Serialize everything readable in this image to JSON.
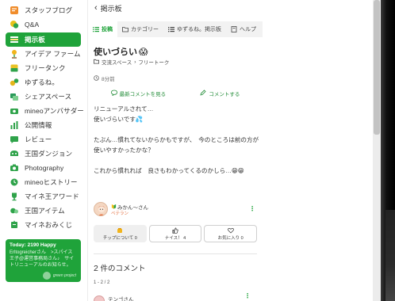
{
  "sidebar": {
    "items": [
      {
        "label": "スタッフブログ",
        "icon": "staff-blog-icon",
        "color": "#f08c2a"
      },
      {
        "label": "Q&A",
        "icon": "qa-icon",
        "color": "#e8c21a"
      },
      {
        "label": "掲示板",
        "icon": "board-icon",
        "color": "#ffffff"
      },
      {
        "label": "アイデア ファーム",
        "icon": "idea-farm-icon",
        "color": "#f2b51c"
      },
      {
        "label": "フリータンク",
        "icon": "free-tank-icon",
        "color": "#e9c225"
      },
      {
        "label": "ゆずるね。",
        "icon": "yuzurune-icon",
        "color": "#e4b51a"
      },
      {
        "label": "シェアスペース",
        "icon": "share-space-icon",
        "color": "#2a9a5a"
      },
      {
        "label": "mineoアンバサダー",
        "icon": "ambassador-icon",
        "color": "#2fa34a"
      },
      {
        "label": "公開情報",
        "icon": "public-info-icon",
        "color": "#2fa34a"
      },
      {
        "label": "レビュー",
        "icon": "review-icon",
        "color": "#2fa34a"
      },
      {
        "label": "王国ダンジョン",
        "icon": "dungeon-icon",
        "color": "#2fa34a"
      },
      {
        "label": "Photography",
        "icon": "camera-icon",
        "color": "#2fa34a"
      },
      {
        "label": "mineoヒストリー",
        "icon": "history-icon",
        "color": "#2fa34a"
      },
      {
        "label": "マイネ王アワード",
        "icon": "trophy-icon",
        "color": "#2fa34a"
      },
      {
        "label": "王国アイテム",
        "icon": "item-icon",
        "color": "#2fa34a"
      },
      {
        "label": "マイネおみくじ",
        "icon": "omikuji-icon",
        "color": "#2fa34a"
      }
    ],
    "active_index": 2,
    "promo": {
      "title": "Today: 2190 Happy",
      "text": "Erltogreicherさん　>スパイス王子@運営事務局さん♪　サイトリニューアルのお知らせ。",
      "brand": "green project"
    }
  },
  "header": {
    "back_icon": "chevron-left-icon",
    "title": "掲示板"
  },
  "tabs": [
    {
      "label": "投稿",
      "icon": "list-icon",
      "active": true
    },
    {
      "label": "カテゴリー",
      "icon": "folder-icon",
      "active": false
    },
    {
      "label": "ゆずるね。掲示板",
      "icon": "list-icon",
      "active": false
    },
    {
      "label": "ヘルプ",
      "icon": "help-book-icon",
      "active": false
    }
  ],
  "post": {
    "title": "使いづらい",
    "title_emoji": "😱",
    "breadcrumb": [
      "交流スペース",
      "フリートーク"
    ],
    "time": "8分前",
    "latest_comment_link": "最新コメントを見る",
    "comment_link": "コメントする",
    "body_lines": [
      "リニューアルされて…",
      "使いづらいです💦",
      "",
      "たぶん…慣れてないからかもですが、　今のところは前の方が",
      "使いやすかったかな？",
      "",
      "これから慣れれば　良さもわかってくるのかしら…😁😁"
    ],
    "author": {
      "name": "みかん〜さん",
      "rank": "ベテラン"
    },
    "buttons": {
      "tip": "チップについて 0",
      "nice": "ナイス！ 4",
      "favorite": "お気に入り 0"
    }
  },
  "comments": {
    "count": "2",
    "count_suffix": " 件のコメント",
    "paging": "1 - 2 / 2",
    "first_commenter": "テンゴさん"
  },
  "colors": {
    "brand_green": "#1fa33a",
    "link_green": "#1e8a34",
    "rank_orange": "#e46c3b"
  }
}
